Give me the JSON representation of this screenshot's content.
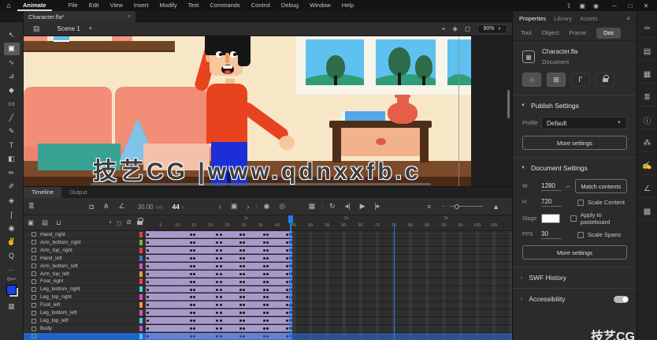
{
  "menubar": {
    "items": [
      "Animate",
      "File",
      "Edit",
      "View",
      "Insert",
      "Modify",
      "Text",
      "Commands",
      "Control",
      "Debug",
      "Window",
      "Help"
    ],
    "titlebar_icons": [
      {
        "name": "share-icon",
        "glyph": "⇧"
      },
      {
        "name": "workspace-layout-icon",
        "glyph": "▣"
      },
      {
        "name": "record-icon",
        "glyph": "◉"
      }
    ],
    "window_controls": [
      {
        "name": "minimize-button",
        "glyph": "─"
      },
      {
        "name": "maximize-button",
        "glyph": "□"
      },
      {
        "name": "close-button",
        "glyph": "✕"
      }
    ]
  },
  "document_tab": {
    "title": "Character.fla*",
    "close": "×"
  },
  "edit_bar": {
    "scene": "Scene 1",
    "zoom": "90%",
    "right_icons": [
      {
        "name": "center-stage-icon",
        "glyph": "⌖"
      },
      {
        "name": "rotate-view-icon",
        "glyph": "◈"
      },
      {
        "name": "clip-content-icon",
        "glyph": "◻"
      }
    ]
  },
  "toolbar": {
    "tools": [
      {
        "name": "selection-tool",
        "glyph": "↖",
        "selected": false
      },
      {
        "name": "subselection-tool",
        "glyph": "▣",
        "selected": true
      },
      {
        "name": "lasso-tool",
        "glyph": "∿",
        "selected": false
      },
      {
        "name": "free-transform-tool",
        "glyph": "⊿",
        "selected": false
      },
      {
        "name": "eraser-tool",
        "glyph": "◆",
        "selected": false
      },
      {
        "name": "rectangle-tool",
        "glyph": "▭",
        "selected": false
      },
      {
        "name": "line-tool",
        "glyph": "╱",
        "selected": false
      },
      {
        "name": "pen-tool",
        "glyph": "✎",
        "selected": false
      },
      {
        "name": "text-tool",
        "glyph": "T",
        "selected": false
      },
      {
        "name": "paint-bucket-tool",
        "glyph": "◧",
        "selected": false
      },
      {
        "name": "brush-tool",
        "glyph": "✏",
        "selected": false
      },
      {
        "name": "pencil-tool",
        "glyph": "✐",
        "selected": false
      },
      {
        "name": "width-tool",
        "glyph": "◈",
        "selected": false
      },
      {
        "name": "bone-tool",
        "glyph": "ʃ",
        "selected": false
      },
      {
        "name": "camera-tool",
        "glyph": "◉",
        "selected": false
      },
      {
        "name": "hand-tool",
        "glyph": "✌",
        "selected": false
      },
      {
        "name": "zoom-tool",
        "glyph": "Q",
        "selected": false
      }
    ],
    "more_dots": "⋯"
  },
  "canvas": {
    "watermark_main": "技艺CG |www.qdnxxfb.c",
    "watermark_corner": "技艺CG"
  },
  "timeline": {
    "tabs": [
      "Timeline",
      "Output"
    ],
    "fps": "30.00",
    "fps_unit": "FPS",
    "current_frame": "44",
    "frame_unit": "F",
    "ruler_numbers": [
      5,
      10,
      15,
      20,
      25,
      30,
      35,
      40,
      45,
      50,
      55,
      60,
      65,
      70,
      75,
      80,
      85,
      90,
      95,
      100,
      105
    ],
    "second_markers": [
      {
        "label": "1s",
        "frame": 30
      },
      {
        "label": "2s",
        "frame": 60
      },
      {
        "label": "3s",
        "frame": 90
      }
    ],
    "layers": [
      {
        "name": "Hand_right",
        "color": "#e8452c",
        "selected": false
      },
      {
        "name": "Arm_bottom_right",
        "color": "#7ab648",
        "selected": false
      },
      {
        "name": "Arm_top_right",
        "color": "#e8452c",
        "selected": false
      },
      {
        "name": "Hand_left",
        "color": "#3a7bd5",
        "selected": false
      },
      {
        "name": "Arm_bottom_left",
        "color": "#d94fd0",
        "selected": false
      },
      {
        "name": "Arm_top_left",
        "color": "#f09a3e",
        "selected": false
      },
      {
        "name": "Foot_right",
        "color": "#e8452c",
        "selected": false
      },
      {
        "name": "Leg_bottom_right",
        "color": "#45c8e8",
        "selected": false
      },
      {
        "name": "Leg_top_right",
        "color": "#d94fd0",
        "selected": false
      },
      {
        "name": "Foot_left",
        "color": "#f09a3e",
        "selected": false
      },
      {
        "name": "Leg_bottom_left",
        "color": "#d94fd0",
        "selected": false
      },
      {
        "name": "Leg_top_left",
        "color": "#45c8e8",
        "selected": false
      },
      {
        "name": "Body",
        "color": "#c44fd9",
        "selected": false
      },
      {
        "name": "",
        "color": "#45c8e8",
        "selected": true
      }
    ],
    "tween": {
      "start": 1,
      "end": 44,
      "keyframes": [
        1,
        14,
        15,
        22,
        23,
        29,
        30,
        36,
        37,
        43
      ]
    },
    "playhead_frame": 44,
    "marker_frame": 75,
    "tween_color": "#a79ac8",
    "playhead_color": "#1f7fe8"
  },
  "properties": {
    "tabs": [
      "Properties",
      "Library",
      "Assets"
    ],
    "active_tab": "Properties",
    "subtabs": [
      "Tool",
      "Object",
      "Frame",
      "Doc"
    ],
    "active_subtab": "Doc",
    "doc_name": "Character.fla",
    "doc_type": "Document",
    "publish": {
      "title": "Publish Settings",
      "profile_label": "Profile",
      "profile_value": "Default",
      "more_button": "More settings"
    },
    "doc_settings": {
      "title": "Document Settings",
      "w_label": "W",
      "w_value": "1280",
      "h_label": "H",
      "h_value": "720",
      "match_button": "Match contents",
      "scale_content": "Scale Content",
      "stage_label": "Stage",
      "apply_pasteboard": "Apply to pasteboard",
      "fps_label": "FPS",
      "fps_value": "30",
      "scale_spans": "Scale Spans",
      "more_button": "More settings"
    },
    "swf_history": "SWF History",
    "accessibility": "Accessibility"
  },
  "dock": {
    "icons": [
      {
        "name": "brushes-panel-icon",
        "glyph": "✑"
      },
      {
        "name": "keyboard-shortcuts-panel-icon",
        "glyph": "▤"
      },
      {
        "name": "align-panel-icon",
        "glyph": "▦"
      },
      {
        "name": "library-panel-icon",
        "glyph": "≣"
      },
      {
        "name": "info-panel-icon",
        "glyph": "ⓘ"
      },
      {
        "name": "particles-panel-icon",
        "glyph": "⁂"
      },
      {
        "name": "draw-panel-icon",
        "glyph": "✍"
      },
      {
        "name": "motion-editor-panel-icon",
        "glyph": "∠"
      },
      {
        "name": "components-panel-icon",
        "glyph": "▩"
      }
    ]
  }
}
